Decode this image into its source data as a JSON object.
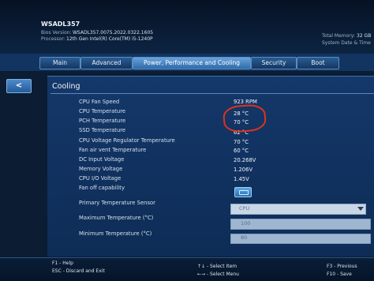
{
  "system": {
    "model": "WSADL357",
    "bios_label": "Bios Version:",
    "bios_value": "WSADL357.0075.2022.0322.1605",
    "processor_label": "Processor:",
    "processor_value": "12th Gen Intel(R) Core(TM) i5-1240P",
    "total_memory_label": "Total Memory:",
    "total_memory_value": "32 GB",
    "date_time_label": "System Date & Time"
  },
  "tabs": [
    {
      "label": "Main"
    },
    {
      "label": "Advanced"
    },
    {
      "label": "Power, Performance and Cooling",
      "active": true
    },
    {
      "label": "Security"
    },
    {
      "label": "Boot"
    }
  ],
  "nav": {
    "back_glyph": "<"
  },
  "section": {
    "title": "Cooling"
  },
  "settings": [
    {
      "label": "CPU Fan Speed",
      "value": "923 RPM"
    },
    {
      "label": "CPU Temperature",
      "value": "28 °C"
    },
    {
      "label": "PCH Temperature",
      "value": "70 °C"
    },
    {
      "label": "SSD Temperature",
      "value": "62 °C"
    },
    {
      "label": "CPU Voltage Regulator Temperature",
      "value": "70 °C"
    },
    {
      "label": "Fan air vent Temperature",
      "value": "60 °C"
    },
    {
      "label": "DC Input Voltage",
      "value": "20.268V"
    },
    {
      "label": "Memory Voltage",
      "value": "1.206V"
    },
    {
      "label": "CPU I/O Voltage",
      "value": "1.45V"
    },
    {
      "label": "Fan off capability",
      "value": ""
    }
  ],
  "primary_sensor": {
    "label": "Primary Temperature Sensor",
    "value": "CPU"
  },
  "max_temp": {
    "label": "Maximum Temperature (°C)",
    "value": "100"
  },
  "min_temp": {
    "label": "Minimum Temperature (°C)",
    "value": "80"
  },
  "footer": {
    "f1": "F1 - Help",
    "esc": "ESC - Discard and Exit",
    "select_item": "↑↓ - Select Item",
    "select_menu": "←→ - Select Menu",
    "f3": "F3 - Previous",
    "f10": "F10 - Save"
  },
  "colors": {
    "background": "#0b1c33",
    "tab_active": "#4f8cc9",
    "panel": "#12345f",
    "annotation": "#e0321e"
  }
}
